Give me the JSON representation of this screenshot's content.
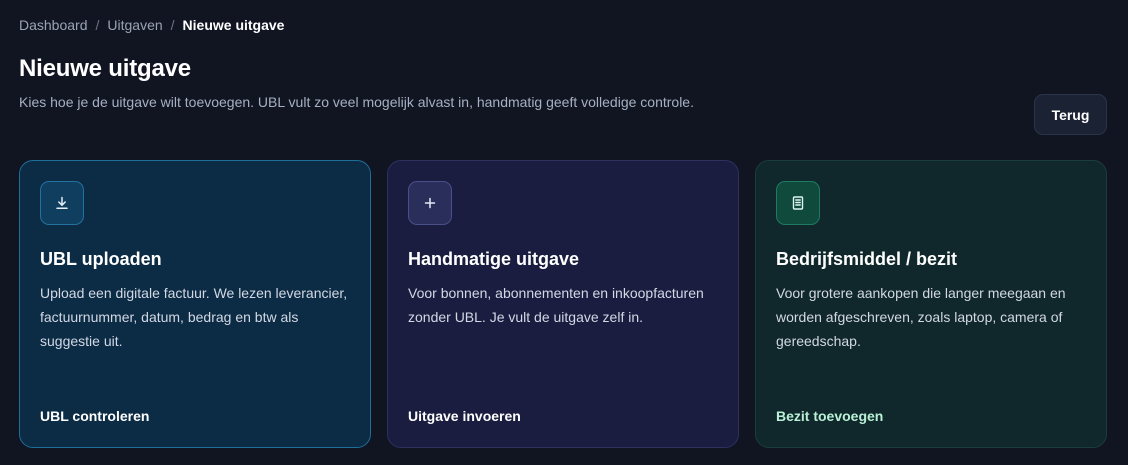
{
  "breadcrumb": {
    "items": [
      "Dashboard",
      "Uitgaven"
    ],
    "current": "Nieuwe uitgave",
    "separator": "/"
  },
  "header": {
    "title": "Nieuwe uitgave",
    "subtitle": "Kies hoe je de uitgave wilt toevoegen. UBL vult zo veel mogelijk alvast in, handmatig geeft volledige controle.",
    "back_label": "Terug"
  },
  "cards": [
    {
      "icon": "download-icon",
      "title": "UBL uploaden",
      "description": "Upload een digitale factuur. We lezen leverancier, factuurnummer, datum, bedrag en btw als suggestie uit.",
      "action": "UBL controleren",
      "accent": "#1f6d9a"
    },
    {
      "icon": "plus-icon",
      "title": "Handmatige uitgave",
      "description": "Voor bonnen, abonnementen en inkoopfacturen zonder UBL. Je vult de uitgave zelf in.",
      "action": "Uitgave invoeren",
      "accent": "#4a4f8a"
    },
    {
      "icon": "document-icon",
      "title": "Bedrijfsmiddel / bezit",
      "description": "Voor grotere aankopen die langer meegaan en worden afgeschreven, zoals laptop, camera of gereedschap.",
      "action": "Bezit toevoegen",
      "accent": "#1f7a62"
    }
  ]
}
